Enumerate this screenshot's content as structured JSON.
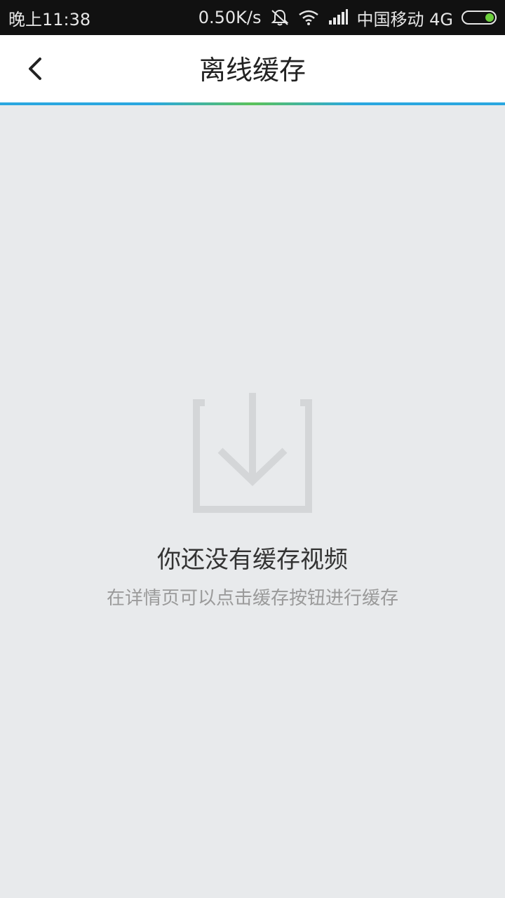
{
  "status_bar": {
    "time": "晚上11:38",
    "speed": "0.50K/s",
    "carrier": "中国移动 4G",
    "icons": [
      "mute-icon",
      "wifi-icon",
      "signal-icon",
      "battery-icon"
    ],
    "battery_color": "#6ccf3c"
  },
  "header": {
    "title": "离线缓存",
    "back_icon": "chevron-left-icon",
    "accent_colors": [
      "#2aa7e0",
      "#5bc25a"
    ]
  },
  "empty_state": {
    "icon": "download-icon",
    "title": "你还没有缓存视频",
    "subtitle": "在详情页可以点击缓存按钮进行缓存"
  }
}
